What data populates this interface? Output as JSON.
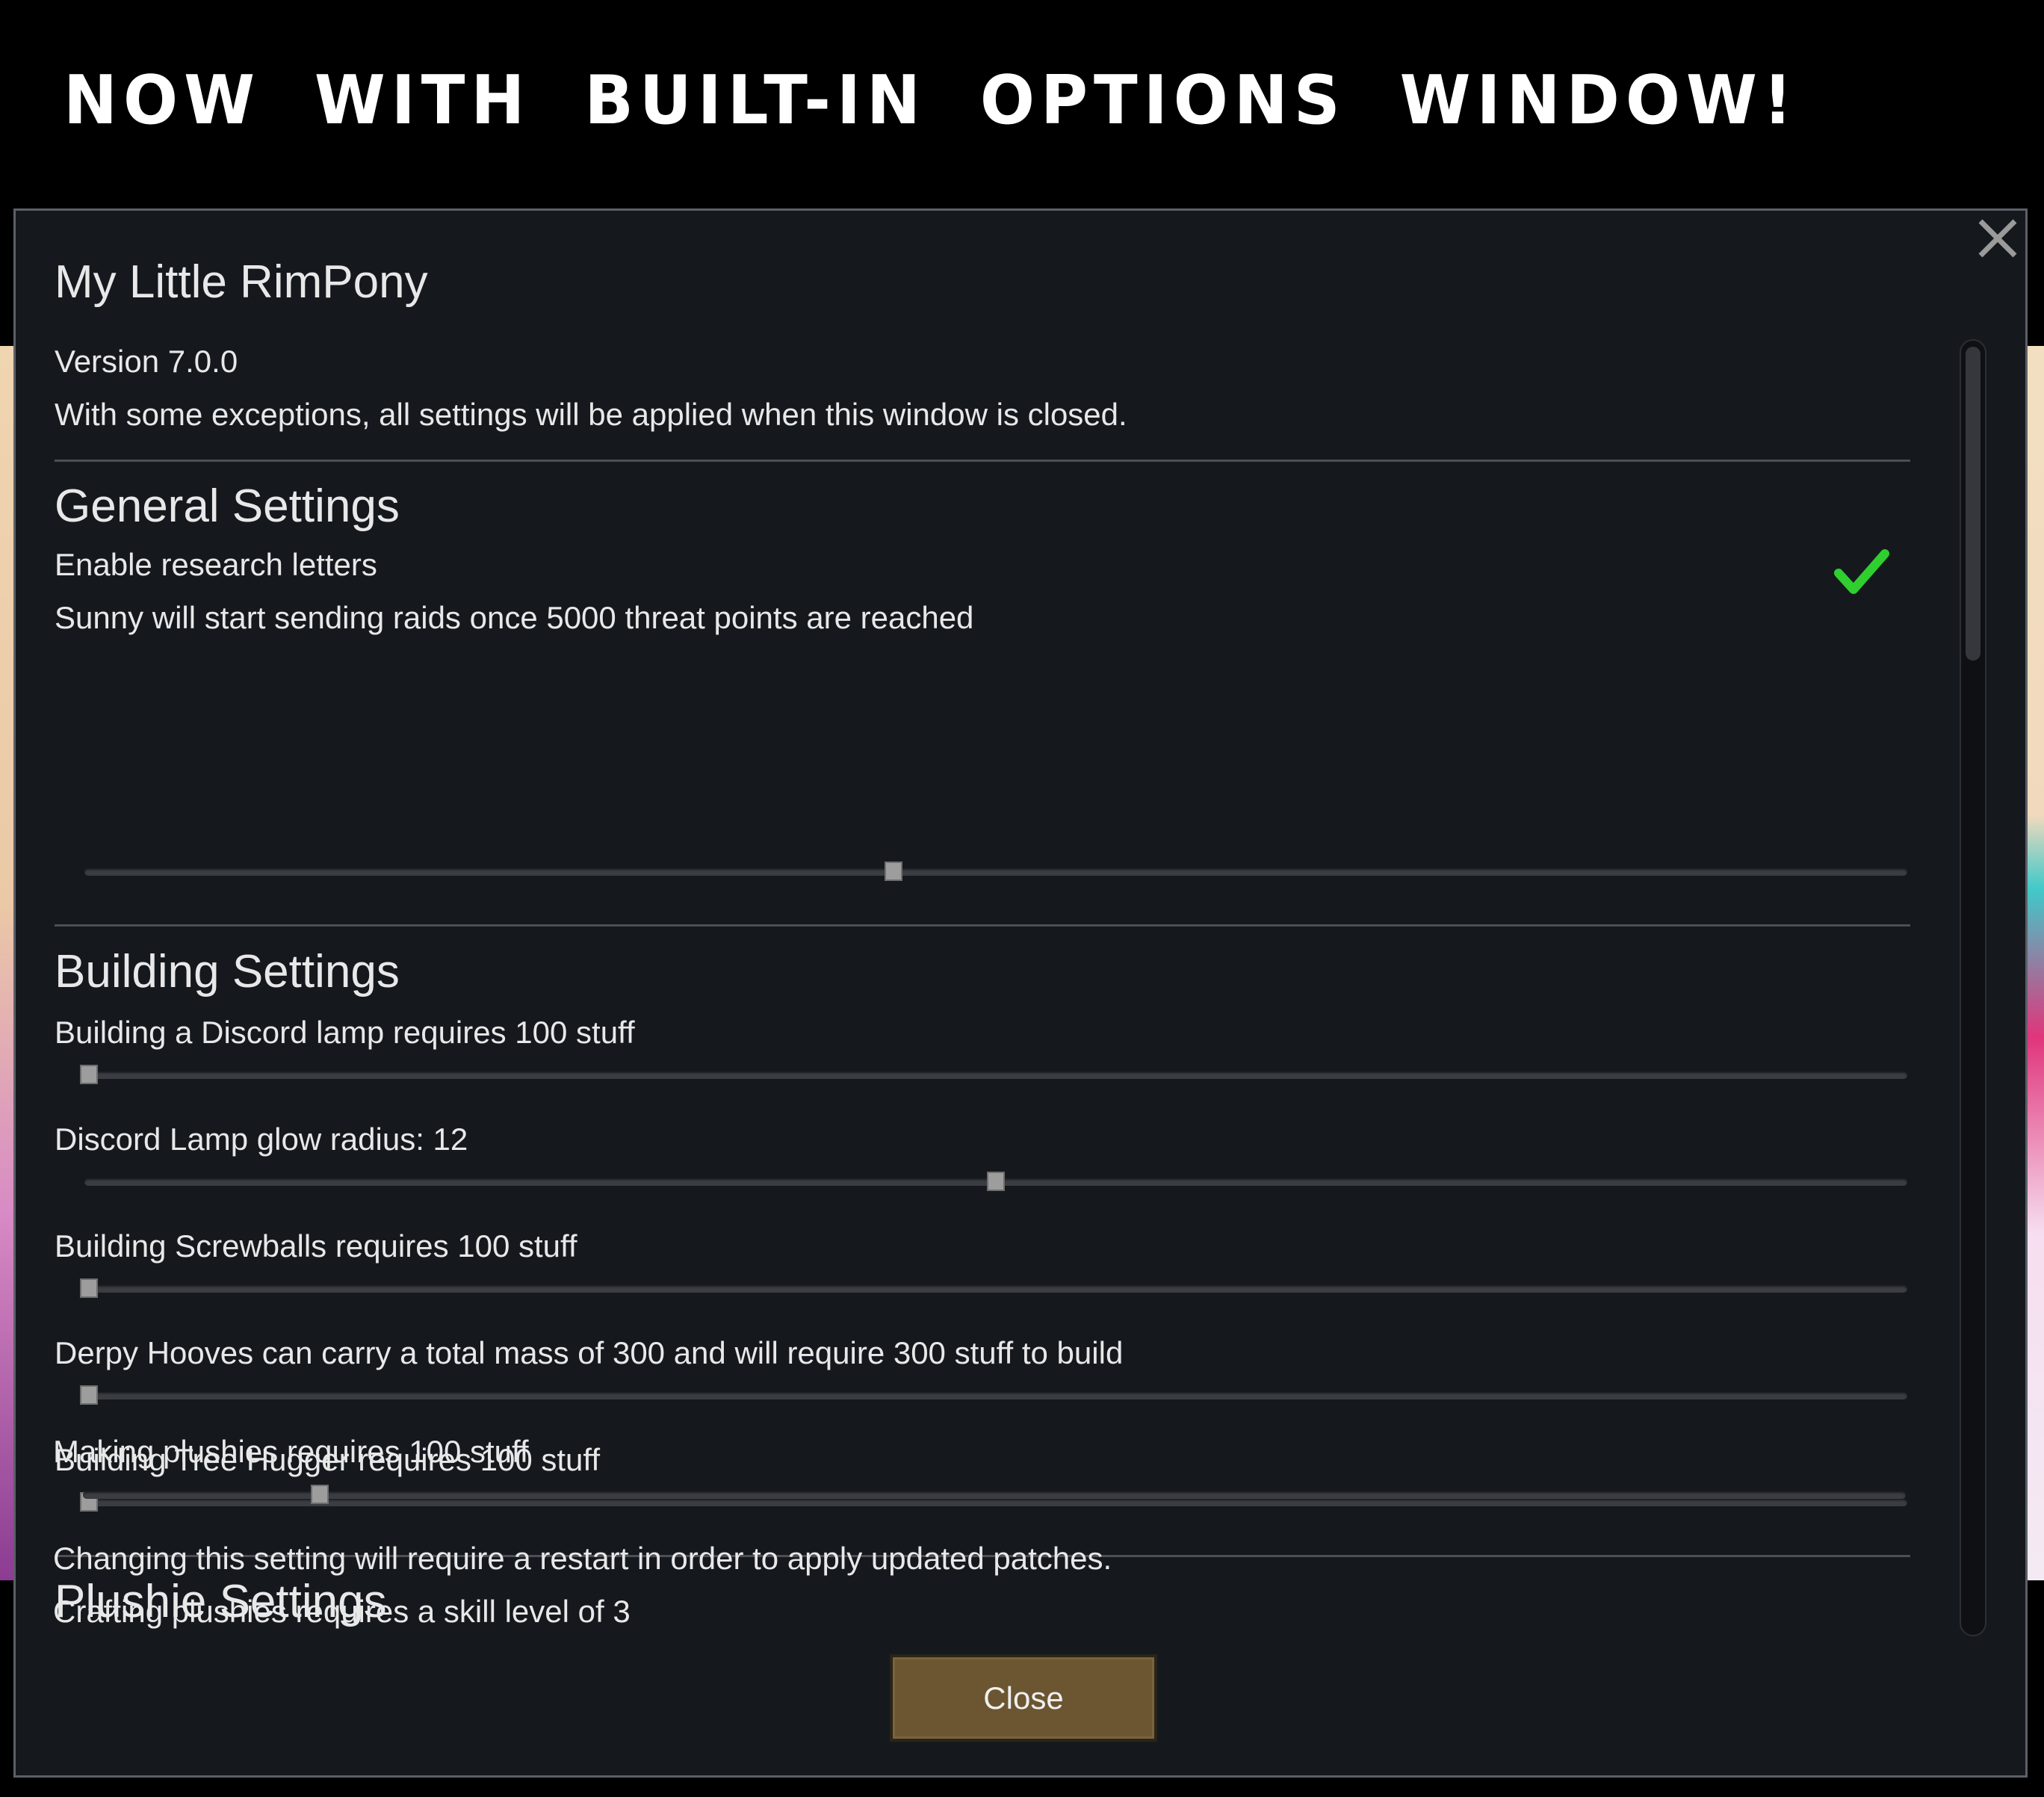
{
  "banner": {
    "text": "Now with built-in options window!"
  },
  "window": {
    "mod_title": "My Little RimPony",
    "version": "Version 7.0.0",
    "note": "With some exceptions, all settings will be applied when this window is closed.",
    "close_button_label": "Close"
  },
  "general": {
    "title": "General Settings",
    "research_letters_label": "Enable research letters",
    "research_letters_checked": true,
    "raids_label": "Sunny will start sending raids once 5000 threat points are reached",
    "raids_slider_fraction": 0.444
  },
  "building": {
    "title": "Building Settings",
    "discord_lamp_cost_label": "Building a Discord lamp requires 100 stuff",
    "discord_lamp_cost_fraction": 0.0,
    "discord_lamp_radius_label": "Discord Lamp glow radius: 12",
    "discord_lamp_radius_fraction": 0.5,
    "screwballs_label": "Building Screwballs requires 100 stuff",
    "screwballs_fraction": 0.0,
    "derpy_label": "Derpy Hooves can carry a total mass of 300 and will require 300 stuff to build",
    "derpy_fraction": 0.0,
    "tree_hugger_label": "Building Tree Hugger requires 100 stuff",
    "tree_hugger_fraction": 0.0
  },
  "plushie": {
    "title": "Plushie Settings",
    "making_label": "Making plushies requires 100 stuff",
    "making_fraction": 0.13,
    "restart_note": "Changing this setting will require a restart in order to apply updated patches.",
    "skill_label": "Crafting plushies requires a skill level of 3"
  },
  "icons": {
    "close": "close-x-icon",
    "check": "checkmark-icon"
  },
  "colors": {
    "checkmark": "#2fcf2f",
    "close_button": "#6c5631",
    "window_bg": "#15191e"
  }
}
